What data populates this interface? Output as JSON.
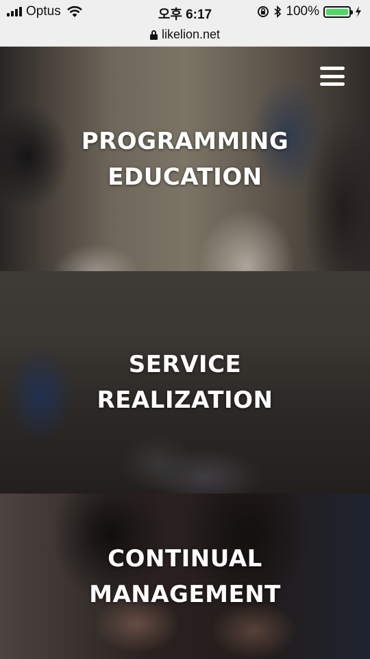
{
  "status_bar": {
    "carrier": "Optus",
    "time": "오후 6:17",
    "battery_percent": "100%",
    "battery_level": 1.0,
    "battery_color": "#4cd964"
  },
  "browser": {
    "url": "likelion.net"
  },
  "nav": {
    "menu_icon": "hamburger-menu-icon"
  },
  "panels": [
    {
      "line1": "PROGRAMMING",
      "line2": "EDUCATION"
    },
    {
      "line1": "SERVICE",
      "line2": "REALIZATION"
    },
    {
      "line1": "CONTINUAL",
      "line2": "MANAGEMENT"
    }
  ]
}
